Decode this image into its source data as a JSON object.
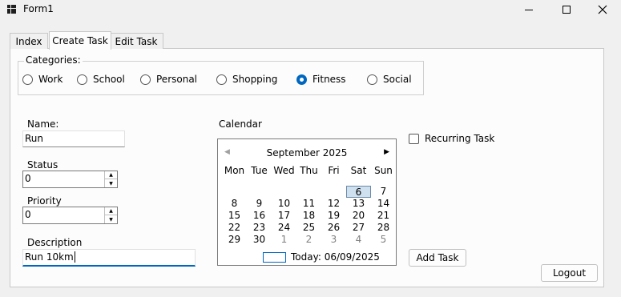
{
  "window": {
    "title": "Form1"
  },
  "tabs": [
    {
      "label": "Index"
    },
    {
      "label": "Create Task"
    },
    {
      "label": "Edit Task"
    }
  ],
  "categories": {
    "label": "Categories:",
    "options": [
      {
        "label": "Work",
        "selected": false
      },
      {
        "label": "School",
        "selected": false
      },
      {
        "label": "Personal",
        "selected": false
      },
      {
        "label": "Shopping",
        "selected": false
      },
      {
        "label": "Fitness",
        "selected": true
      },
      {
        "label": "Social",
        "selected": false
      }
    ]
  },
  "form": {
    "name_label": "Name:",
    "name_value": "Run",
    "status_label": "Status",
    "status_value": "0",
    "priority_label": "Priority",
    "priority_value": "0",
    "description_label": "Description",
    "description_value": "Run 10km"
  },
  "calendar": {
    "label": "Calendar",
    "month": "September 2025",
    "weekdays": [
      "Mon",
      "Tue",
      "Wed",
      "Thu",
      "Fri",
      "Sat",
      "Sun"
    ],
    "week1": [
      "",
      "",
      "",
      "",
      "",
      "6",
      "7"
    ],
    "week2": [
      "8",
      "9",
      "10",
      "11",
      "12",
      "13",
      "14"
    ],
    "week3": [
      "15",
      "16",
      "17",
      "18",
      "19",
      "20",
      "21"
    ],
    "week4": [
      "22",
      "23",
      "24",
      "25",
      "26",
      "27",
      "28"
    ],
    "week5": [
      "29",
      "30",
      "1",
      "2",
      "3",
      "4",
      "5"
    ],
    "selected_day": "6",
    "today_text": "Today: 06/09/2025"
  },
  "recurring": {
    "label": "Recurring Task",
    "checked": false
  },
  "buttons": {
    "add_task": "Add Task",
    "logout": "Logout"
  }
}
